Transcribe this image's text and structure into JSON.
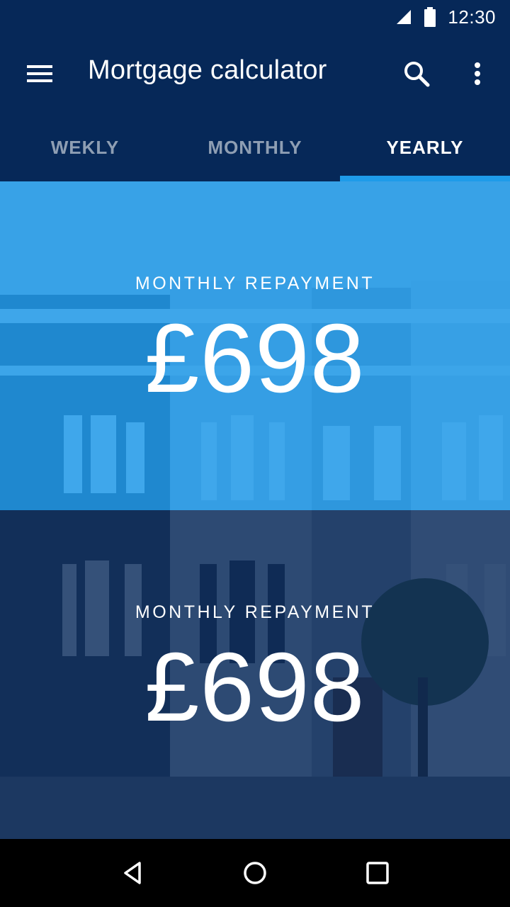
{
  "status_bar": {
    "time": "12:30",
    "signal_icon": "signal-icon",
    "battery_icon": "battery-icon"
  },
  "app_bar": {
    "title": "Mortgage calculator",
    "menu_icon": "menu-icon",
    "search_icon": "search-icon",
    "more_icon": "more-vert-icon"
  },
  "tabs": [
    {
      "label": "WEKLY",
      "active": false
    },
    {
      "label": "MONTHLY",
      "active": false
    },
    {
      "label": "YEARLY",
      "active": true
    }
  ],
  "panels": [
    {
      "label": "MONTHLY REPAYMENT",
      "amount": "£698"
    },
    {
      "label": "MONTHLY REPAYMENT",
      "amount": "£698"
    }
  ],
  "nav_bar": {
    "back_icon": "back-icon",
    "home_icon": "home-icon",
    "recents_icon": "recents-icon"
  },
  "colors": {
    "primary_dark": "#062858",
    "accent": "#1e9be9",
    "panel_light": "#1896e8"
  }
}
